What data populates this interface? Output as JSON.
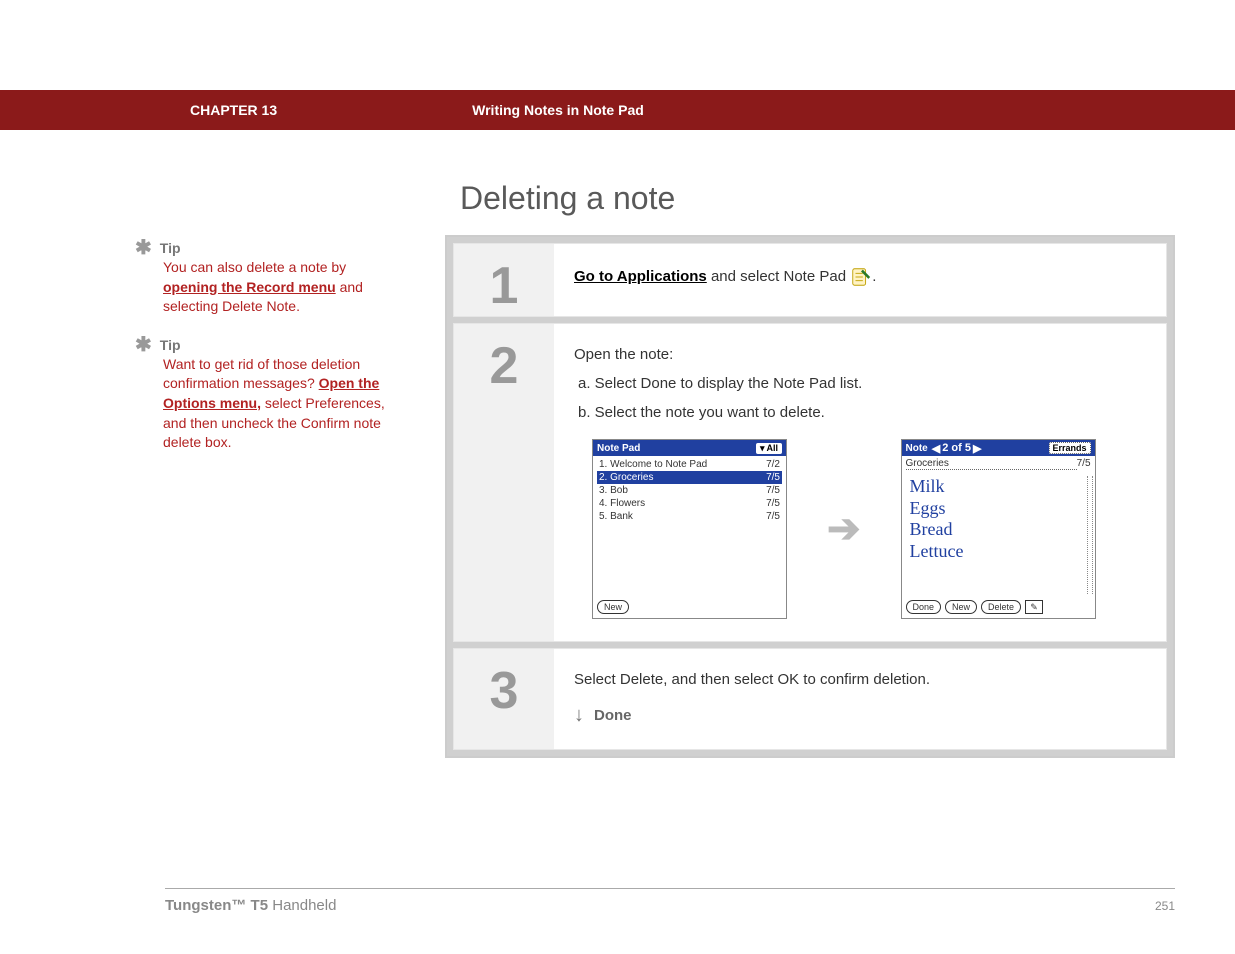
{
  "header": {
    "chapter": "CHAPTER 13",
    "section": "Writing Notes in Note Pad"
  },
  "section_title": "Deleting a note",
  "tips": [
    {
      "label": "Tip",
      "pre": "You can also delete a note by ",
      "link": "opening the Record menu",
      "post": " and selecting Delete Note."
    },
    {
      "label": "Tip",
      "pre": "Want to get rid of those deletion confirmation messages? ",
      "link": "Open the Options menu,",
      "post": " select Preferences, and then uncheck the Confirm note delete box."
    }
  ],
  "steps": {
    "s1": {
      "num": "1",
      "link": "Go to Applications",
      "post": " and select Note Pad ",
      "period": "."
    },
    "s2": {
      "num": "2",
      "intro": "Open the note:",
      "a": "a.  Select Done to display the Note Pad list.",
      "b": "b.  Select the note you want to delete.",
      "list_screen": {
        "title": "Note Pad",
        "filter": "All",
        "rows": [
          {
            "label": "1. Welcome to Note Pad",
            "date": "7/2",
            "sel": false
          },
          {
            "label": "2. Groceries",
            "date": "7/5",
            "sel": true
          },
          {
            "label": "3. Bob",
            "date": "7/5",
            "sel": false
          },
          {
            "label": "4. Flowers",
            "date": "7/5",
            "sel": false
          },
          {
            "label": "5. Bank",
            "date": "7/5",
            "sel": false
          }
        ],
        "new_btn": "New"
      },
      "note_screen": {
        "title": "Note",
        "counter": "2 of 5",
        "category": "Errands",
        "note_title": "Groceries",
        "note_date": "7/5",
        "lines": [
          "Milk",
          "Eggs",
          "Bread",
          "Lettuce"
        ],
        "done": "Done",
        "new": "New",
        "delete": "Delete"
      }
    },
    "s3": {
      "num": "3",
      "text": "Select Delete, and then select OK to confirm deletion.",
      "done": "Done"
    }
  },
  "footer": {
    "product_bold": "Tungsten™ T5",
    "product_rest": " Handheld",
    "page": "251"
  }
}
